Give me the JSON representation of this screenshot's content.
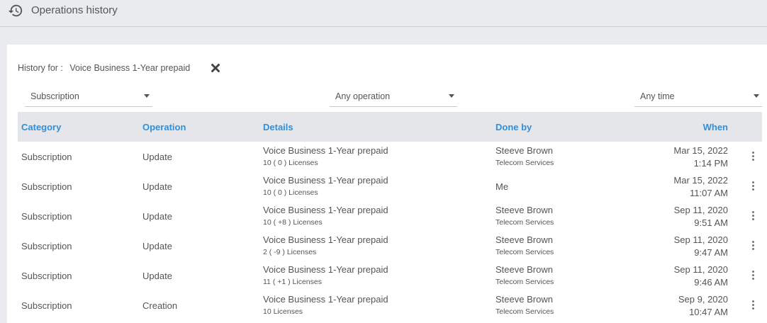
{
  "header": {
    "title": "Operations history",
    "icon": "history-icon"
  },
  "filter": {
    "history_for_label": "History for :",
    "history_for_value": "Voice Business 1-Year prepaid",
    "clear_icon": "close-icon"
  },
  "dropdowns": {
    "category": "Subscription",
    "operation": "Any operation",
    "time": "Any time"
  },
  "table": {
    "columns": [
      "Category",
      "Operation",
      "Details",
      "Done by",
      "When"
    ],
    "rows": [
      {
        "category": "Subscription",
        "operation": "Update",
        "details": "Voice Business 1-Year prepaid",
        "sub": "10 ( 0 ) Licenses",
        "by": "Steeve Brown",
        "org": "Telecom Services",
        "date": "Mar 15, 2022",
        "time": "1:14 PM"
      },
      {
        "category": "Subscription",
        "operation": "Update",
        "details": "Voice Business 1-Year prepaid",
        "sub": "10 ( 0 ) Licenses",
        "by": "Me",
        "org": "",
        "date": "Mar 15, 2022",
        "time": "11:07 AM"
      },
      {
        "category": "Subscription",
        "operation": "Update",
        "details": "Voice Business 1-Year prepaid",
        "sub": "10 ( +8 ) Licenses",
        "by": "Steeve Brown",
        "org": "Telecom Services",
        "date": "Sep 11, 2020",
        "time": "9:51 AM"
      },
      {
        "category": "Subscription",
        "operation": "Update",
        "details": "Voice Business 1-Year prepaid",
        "sub": "2 ( -9 ) Licenses",
        "by": "Steeve Brown",
        "org": "Telecom Services",
        "date": "Sep 11, 2020",
        "time": "9:47 AM"
      },
      {
        "category": "Subscription",
        "operation": "Update",
        "details": "Voice Business 1-Year prepaid",
        "sub": "11 ( +1 ) Licenses",
        "by": "Steeve Brown",
        "org": "Telecom Services",
        "date": "Sep 11, 2020",
        "time": "9:46 AM"
      },
      {
        "category": "Subscription",
        "operation": "Creation",
        "details": "Voice Business 1-Year prepaid",
        "sub": "10 Licenses",
        "by": "Steeve Brown",
        "org": "Telecom Services",
        "date": "Sep 9, 2020",
        "time": "10:47 AM"
      }
    ]
  },
  "colors": {
    "accent": "#2f8fd8",
    "background": "#eaebee",
    "header_row": "#e5e6ea"
  }
}
